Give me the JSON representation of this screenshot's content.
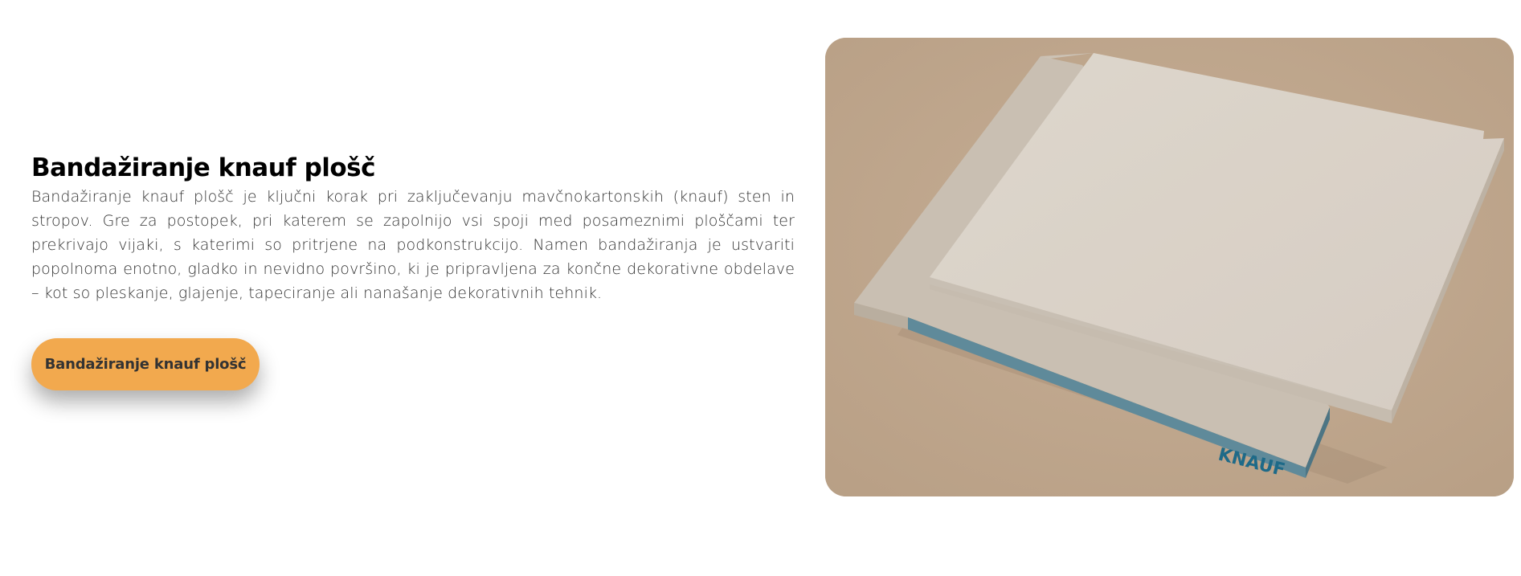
{
  "section": {
    "heading": "Bandažiranje knauf plošč",
    "description": "Bandažiranje knauf plošč je ključni korak pri zaključevanju mavčnokartonskih (knauf) sten in stropov. Gre za postopek, pri katerem se zapolnijo vsi spoji med posameznimi ploščami ter prekrivajo vijaki, s katerimi so pritrjene na podkonstrukcijo. Namen bandažiranja je ustvariti popolnoma enotno, gladko in nevidno površino, ki je pripravljena za končne dekorativne obdelave – kot so pleskanje, glajenje, tapeciranje ali nanašanje dekorativnih tehnik.",
    "button_label": "Bandažiranje knauf plošč"
  },
  "image": {
    "brand_text": "KNAUF",
    "colors": {
      "background": "#c1a88e",
      "board_face": "#d9d1c7",
      "board_edge": "#c8beb1",
      "board_core": "#5e8898",
      "brand_text": "#1e6a88"
    }
  },
  "colors": {
    "button": "#f2a94e",
    "heading": "#000000",
    "body_text": "#333333"
  }
}
